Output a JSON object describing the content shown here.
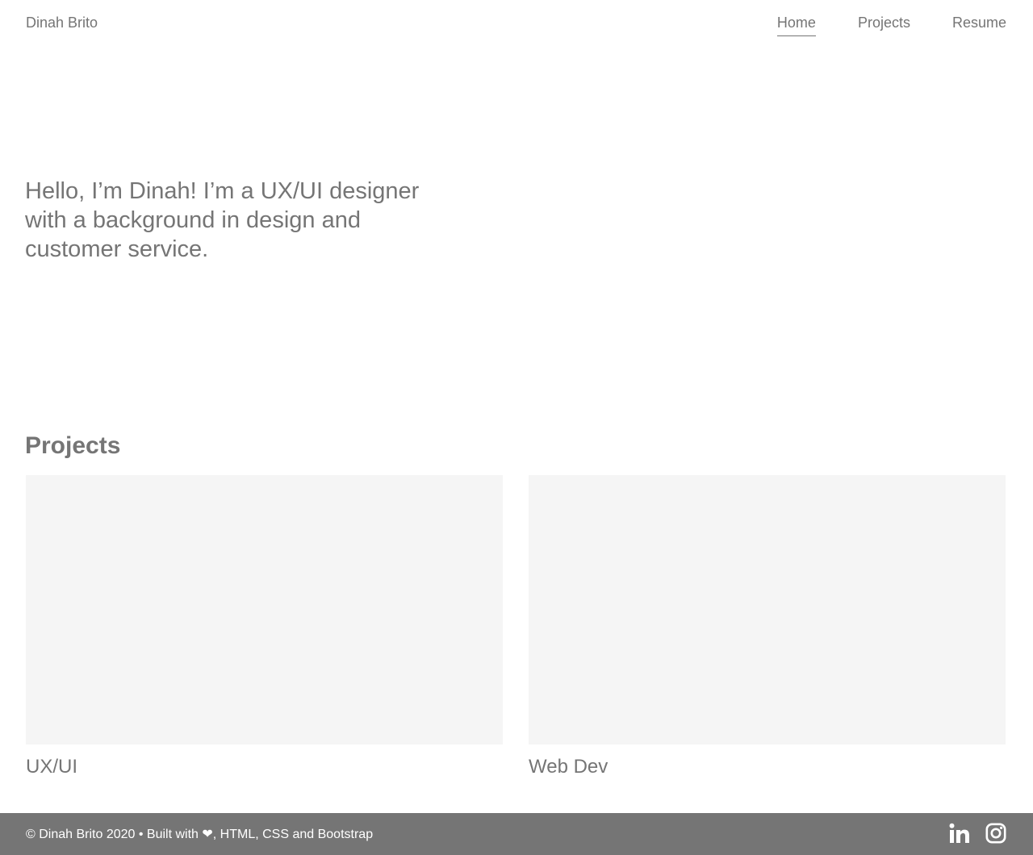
{
  "header": {
    "brand": "Dinah Brito",
    "nav": [
      {
        "label": "Home",
        "active": true
      },
      {
        "label": "Projects",
        "active": false
      },
      {
        "label": "Resume",
        "active": false
      }
    ]
  },
  "hero": {
    "text": "Hello, I’m Dinah! I’m a UX/UI designer with a background in design and customer service."
  },
  "projects": {
    "title": "Projects",
    "items": [
      {
        "label": "UX/UI"
      },
      {
        "label": "Web Dev"
      }
    ]
  },
  "footer": {
    "text": "© Dinah Brito 2020 • Built with ❤, HTML, CSS and Bootstrap",
    "social": [
      {
        "icon": "linkedin-icon"
      },
      {
        "icon": "instagram-icon"
      }
    ]
  },
  "colors": {
    "text": "#757575",
    "footer_bg": "#757575",
    "card_bg": "#f5f5f5"
  }
}
